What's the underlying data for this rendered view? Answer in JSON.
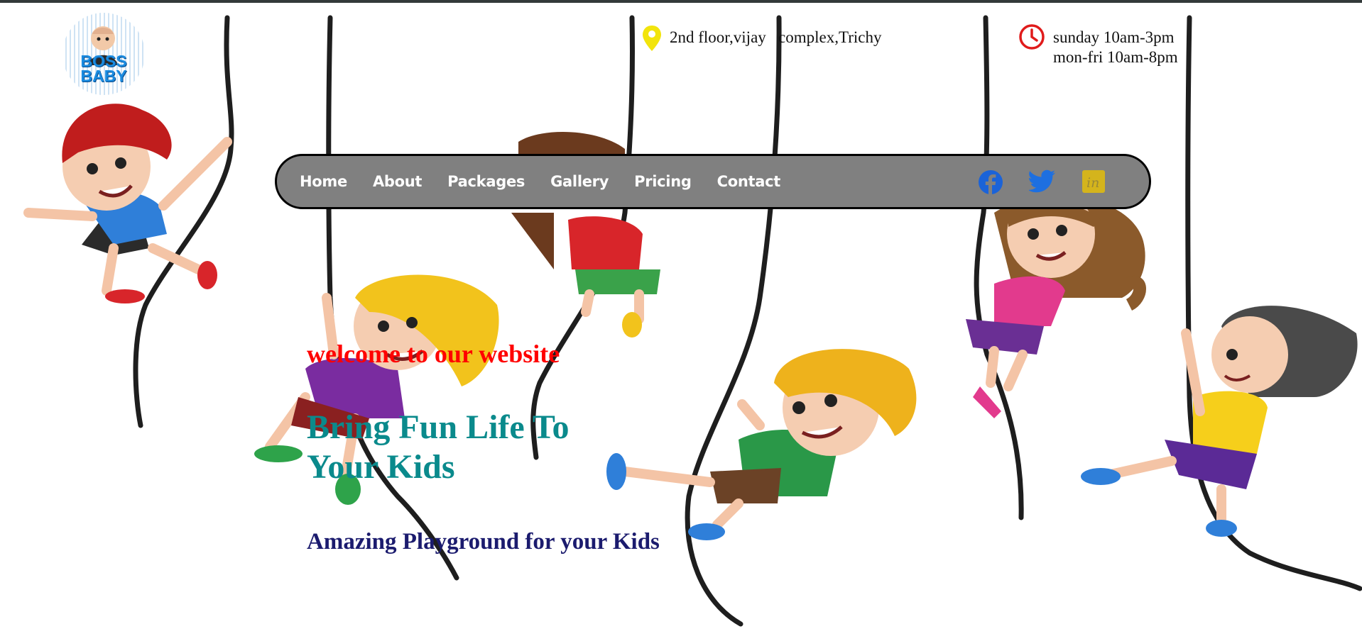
{
  "logo": {
    "text": "BOSS BABY"
  },
  "header": {
    "address": "2nd floor,vijay   complex,Trichy",
    "hours_line1": "sunday 10am-3pm",
    "hours_line2": "mon-fri 10am-8pm",
    "icons": {
      "address": "location-pin-icon",
      "hours": "clock-icon"
    },
    "colors": {
      "pin": "#f2e40c",
      "clock": "#e01b1b"
    }
  },
  "nav": {
    "links": [
      "Home",
      "About",
      "Packages",
      "Gallery",
      "Pricing",
      "Contact"
    ],
    "social": [
      {
        "icon": "facebook-icon",
        "color": "#1b63d8"
      },
      {
        "icon": "twitter-icon",
        "color": "#1d6fe0"
      },
      {
        "icon": "linkedin-icon",
        "color": "#d4b41c"
      }
    ]
  },
  "hero": {
    "welcome": "welcome to our website",
    "headline": "Bring Fun Life To Your Kids",
    "tagline": "Amazing Playground for your Kids"
  },
  "colors": {
    "welcome": "#ff0000",
    "headline": "#0a8a8c",
    "tagline": "#1b1b6e",
    "nav_bg": "#808080"
  }
}
